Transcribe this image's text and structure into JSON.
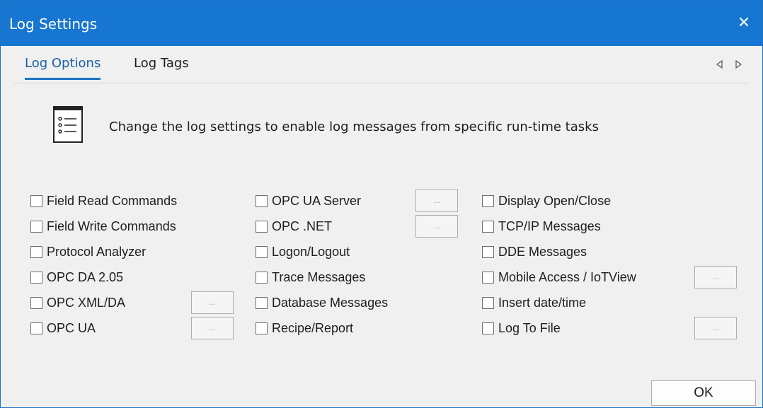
{
  "window": {
    "title": "Log Settings",
    "close_glyph": "×"
  },
  "tabs": [
    {
      "label": "Log Options",
      "active": true
    },
    {
      "label": "Log Tags",
      "active": false
    }
  ],
  "tab_scroll": {
    "left_icon": "triangle-left-icon",
    "right_icon": "triangle-right-icon"
  },
  "info": {
    "icon": "list-document-icon",
    "text": "Change the log settings to enable log messages from specific run-time tasks"
  },
  "options": {
    "col1": [
      {
        "label": "Field Read Commands",
        "checked": false
      },
      {
        "label": "Field Write Commands",
        "checked": false
      },
      {
        "label": "Protocol Analyzer",
        "checked": false
      },
      {
        "label": "OPC DA 2.05",
        "checked": false
      },
      {
        "label": "OPC XML/DA",
        "checked": false
      },
      {
        "label": "OPC UA",
        "checked": false
      }
    ],
    "col2": [
      {
        "label": "OPC UA Server",
        "checked": false
      },
      {
        "label": "OPC .NET",
        "checked": false
      },
      {
        "label": "Logon/Logout",
        "checked": false
      },
      {
        "label": "Trace Messages",
        "checked": false
      },
      {
        "label": "Database Messages",
        "checked": false
      },
      {
        "label": "Recipe/Report",
        "checked": false
      }
    ],
    "col3": [
      {
        "label": "Display Open/Close",
        "checked": false
      },
      {
        "label": "TCP/IP Messages",
        "checked": false
      },
      {
        "label": "DDE Messages",
        "checked": false
      },
      {
        "label": "Mobile Access / IoTView",
        "checked": false
      },
      {
        "label": "Insert date/time",
        "checked": false
      },
      {
        "label": "Log To File",
        "checked": false
      }
    ]
  },
  "ellipsis_label": "...",
  "buttons": {
    "ok": "OK"
  },
  "colors": {
    "titlebar": "#1776d1",
    "accent": "#1a74c4",
    "background": "#f0f0f0"
  }
}
